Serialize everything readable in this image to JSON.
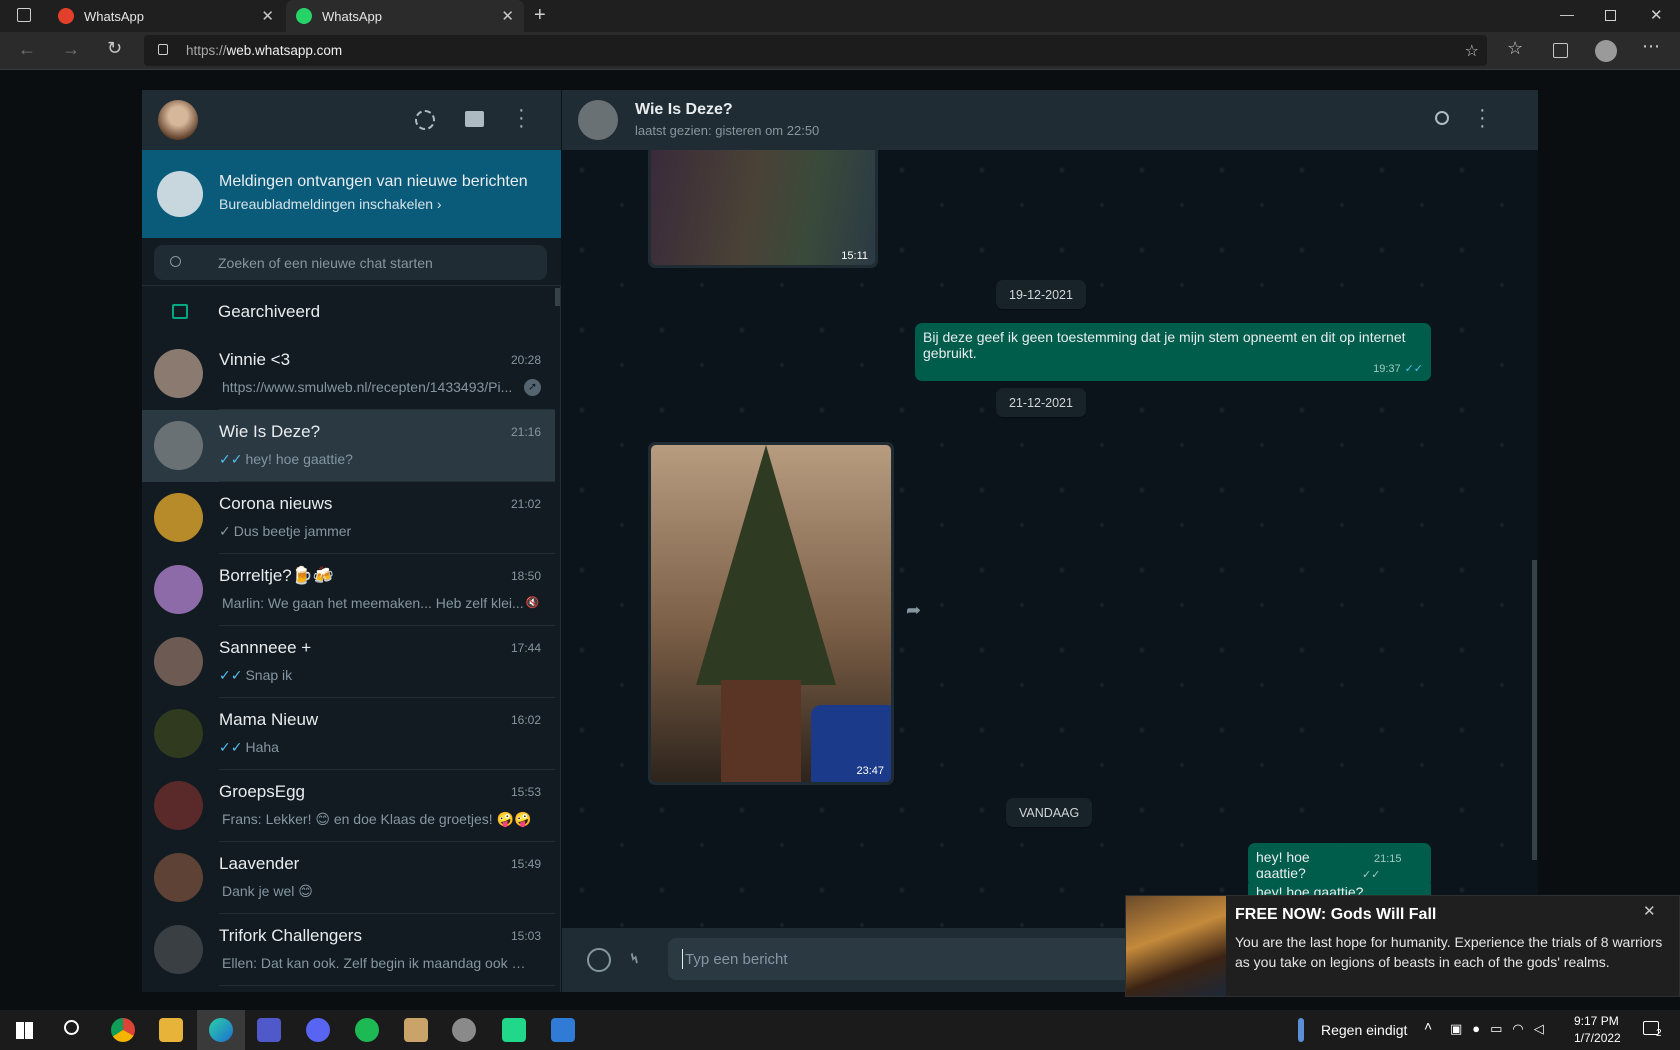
{
  "browser": {
    "tabs": [
      {
        "title": "WhatsApp",
        "active": false
      },
      {
        "title": "WhatsApp",
        "active": true
      }
    ],
    "url_prefix": "https://",
    "url_host": "web.whatsapp.com"
  },
  "sidebar": {
    "notification": {
      "title": "Meldingen ontvangen van nieuwe berichten",
      "subtitle": "Bureaubladmeldingen inschakelen ›"
    },
    "search_placeholder": "Zoeken of een nieuwe chat starten",
    "archived_label": "Gearchiveerd",
    "chats": [
      {
        "name": "Vinnie <3",
        "time": "20:28",
        "preview": "https://www.smulweb.nl/recepten/1433493/Pi...",
        "tick": "",
        "avatar": "#8a7a70"
      },
      {
        "name": "Wie Is Deze?",
        "time": "21:16",
        "preview": "hey! hoe gaattie?",
        "tick": "✓✓",
        "avatar": "#6a7175",
        "active": true
      },
      {
        "name": "Corona nieuws",
        "time": "21:02",
        "preview": "Dus beetje jammer",
        "tick": "✓",
        "avatar": "#b78a2a"
      },
      {
        "name": "Borreltje?🍺🍻",
        "time": "18:50",
        "preview": "Marlin: We gaan het meemaken... Heb zelf klei...",
        "tick": "",
        "avatar": "#8d6aa8"
      },
      {
        "name": "Sannneee +",
        "time": "17:44",
        "preview": "Snap ik",
        "tick": "✓✓",
        "avatar": "#6d5a52"
      },
      {
        "name": "Mama Nieuw",
        "time": "16:02",
        "preview": "Haha",
        "tick": "✓✓",
        "avatar": "#2f3a1e"
      },
      {
        "name": "GroepsEgg",
        "time": "15:53",
        "preview": "Frans: Lekker! 😊 en doe Klaas de groetjes! 🤪🤪",
        "tick": "",
        "avatar": "#5a2a2a"
      },
      {
        "name": "Laavender",
        "time": "15:49",
        "preview": "Dank je wel 😊",
        "tick": "",
        "avatar": "#5e4236"
      },
      {
        "name": "Trifork Challengers",
        "time": "15:03",
        "preview": "Ellen: Dat kan ook. Zelf begin ik maandag ook we...",
        "tick": "",
        "avatar": "#3a3f44"
      }
    ]
  },
  "conversation": {
    "name": "Wie Is Deze?",
    "status": "laatst gezien: gisteren om 22:50",
    "image1_time": "15:11",
    "date1": "19-12-2021",
    "msg1_text": "Bij deze geef ik geen toestemming dat je mijn stem opneemt en dit op internet gebruikt.",
    "msg1_time": "19:37",
    "date2": "21-12-2021",
    "image2_time": "23:47",
    "date3": "VANDAAG",
    "msg2_text": "hey! hoe gaattie?",
    "msg2_time": "21:15",
    "msg3_text": "hey! hoe gaattie?",
    "input_placeholder": "Typ een bericht"
  },
  "toast": {
    "title": "FREE NOW: Gods Will Fall",
    "body": "You are the last hope for humanity. Experience the trials of 8 warriors as you take on legions of beasts in each of the gods' realms."
  },
  "taskbar": {
    "weather": "Regen eindigt",
    "time": "9:17 PM",
    "date": "1/7/2022",
    "notif_count": "2"
  },
  "colors": {
    "accent": "#00a884",
    "bubble_out": "#005c4b",
    "notif_banner": "#0a5b7a"
  }
}
